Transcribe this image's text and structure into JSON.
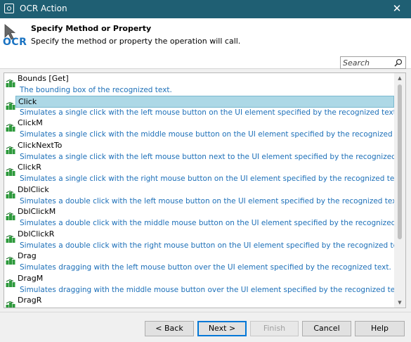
{
  "window": {
    "title": "OCR Action",
    "close_glyph": "✕"
  },
  "header": {
    "logo_text": "OCR",
    "title": "Specify Method or Property",
    "subtitle": "Specify the method or property the operation will call."
  },
  "search": {
    "placeholder": "Search",
    "value": ""
  },
  "items": [
    {
      "name": "Bounds [Get]",
      "description": "The bounding box of the recognized text.",
      "selected": false
    },
    {
      "name": "Click",
      "description": "Simulates a single click with the left mouse button on the UI element specified by the recognized text.",
      "selected": true
    },
    {
      "name": "ClickM",
      "description": "Simulates a single click with the middle mouse button on the UI element specified by the recognized text.",
      "selected": false
    },
    {
      "name": "ClickNextTo",
      "description": "Simulates a single click with the left mouse button next to the UI element specified by the recognized text.",
      "selected": false
    },
    {
      "name": "ClickR",
      "description": "Simulates a single click with the right mouse button on the UI element specified by the recognized text.",
      "selected": false
    },
    {
      "name": "DblClick",
      "description": "Simulates a double click with the left mouse button on the UI element specified by the recognized text.",
      "selected": false
    },
    {
      "name": "DblClickM",
      "description": "Simulates a double click with the middle mouse button on the UI element specified by the recognized text.",
      "selected": false
    },
    {
      "name": "DblClickR",
      "description": "Simulates a double click with the right mouse button on the UI element specified by the recognized text.",
      "selected": false
    },
    {
      "name": "Drag",
      "description": "Simulates dragging with the left mouse button over the UI element specified by the recognized text.",
      "selected": false
    },
    {
      "name": "DragM",
      "description": "Simulates dragging with the middle mouse button over the UI element specified by the recognized text.",
      "selected": false
    },
    {
      "name": "DragR",
      "description": "",
      "selected": false
    }
  ],
  "buttons": {
    "back": "< Back",
    "next": "Next >",
    "finish": "Finish",
    "cancel": "Cancel",
    "help": "Help"
  },
  "colors": {
    "titlebar": "#1f5f73",
    "selection": "#add8e6",
    "description_text": "#1c6fb8",
    "method_icon_green": "#2e9a3c"
  }
}
